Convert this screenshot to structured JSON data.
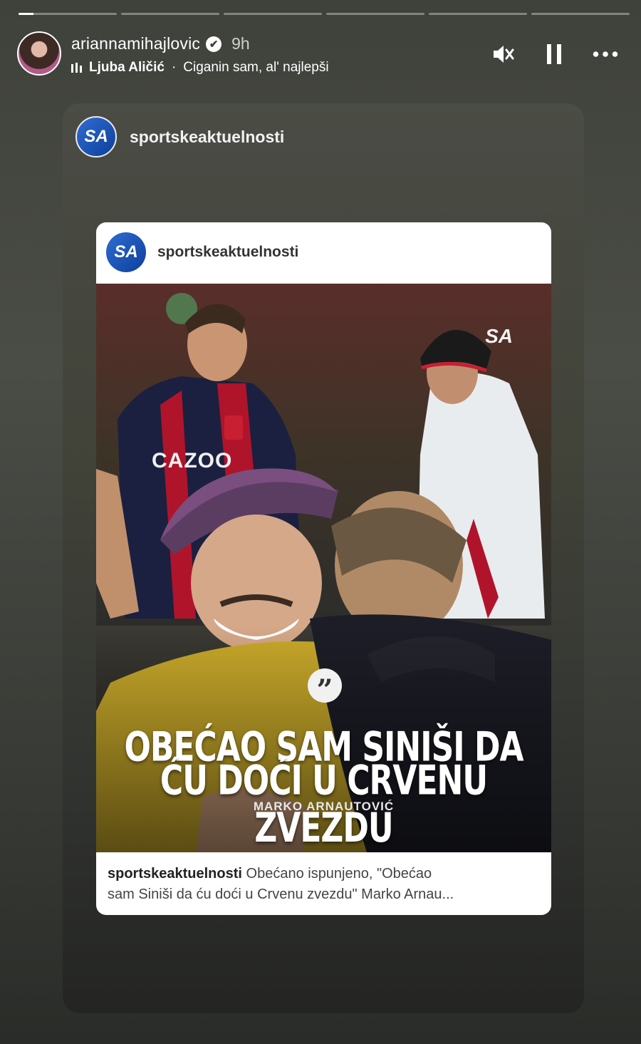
{
  "story": {
    "progress_segments": [
      0.15,
      0,
      0,
      0,
      0,
      0
    ],
    "user": {
      "username": "ariannamihajlovic",
      "verified_glyph": "✔",
      "time": "9h"
    },
    "music": {
      "artist": "Ljuba Aličić",
      "separator": "·",
      "title": "Ciganin sam, al' najlepši"
    },
    "controls": [
      "mute-icon",
      "pause-icon",
      "more-options-icon"
    ]
  },
  "shared_card": {
    "account": {
      "logo_text": "SA",
      "name": "sportskeaktuelnosti"
    },
    "post": {
      "account": {
        "logo_text": "SA",
        "name": "sportskeaktuelnosti"
      },
      "image": {
        "watermark": "SA",
        "jersey_text": "CAZOO",
        "quote_line_1": "OBEĆAO SAM SINIŠI DA",
        "quote_line_2": "ĆU DOĆI U CRVENU ZVEZDU",
        "quote_author": "MARKO ARNAUTOVIĆ"
      },
      "caption": {
        "account": "sportskeaktuelnosti",
        "line1_text": "Obećano ispunjeno, \"Obećao",
        "line2_text": "sam Siniši da ću doći u Crvenu zvezdu\" Marko Arnau..."
      }
    }
  }
}
